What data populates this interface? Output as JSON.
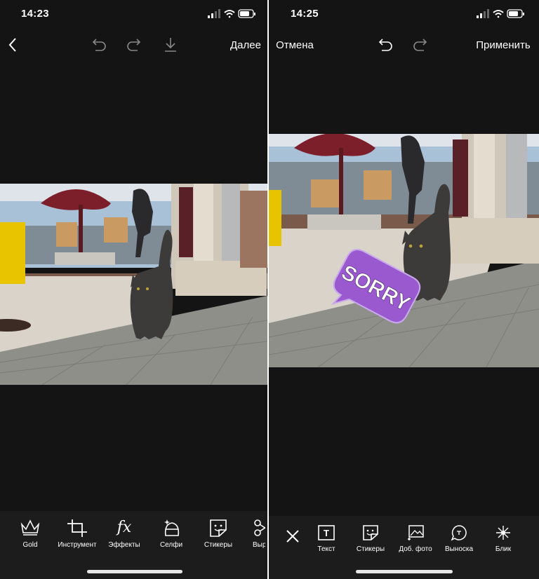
{
  "left": {
    "time": "14:23",
    "topbar": {
      "next_label": "Далее"
    },
    "tools": [
      {
        "icon": "crown-icon",
        "label": "Gold"
      },
      {
        "icon": "crop-icon",
        "label": "Инструмент"
      },
      {
        "icon": "fx-icon",
        "label": "Эффекты",
        "glyph": "fx"
      },
      {
        "icon": "selfie-icon",
        "label": "Селфи"
      },
      {
        "icon": "sticker-icon",
        "label": "Стикеры"
      },
      {
        "icon": "cutout-icon",
        "label": "Выр"
      }
    ]
  },
  "right": {
    "time": "14:25",
    "topbar": {
      "cancel_label": "Отмена",
      "apply_label": "Применить"
    },
    "sticker_text": "SORRY",
    "tools": [
      {
        "icon": "text-icon",
        "label": "Текст",
        "glyph": "T"
      },
      {
        "icon": "sticker-icon",
        "label": "Стикеры"
      },
      {
        "icon": "add-photo-icon",
        "label": "Доб. фото"
      },
      {
        "icon": "callout-icon",
        "label": "Выноска"
      },
      {
        "icon": "flare-icon",
        "label": "Блик"
      }
    ]
  },
  "colors": {
    "background": "#141414",
    "toolbar": "#1c1c1c",
    "sticker": "#9b59d0"
  }
}
